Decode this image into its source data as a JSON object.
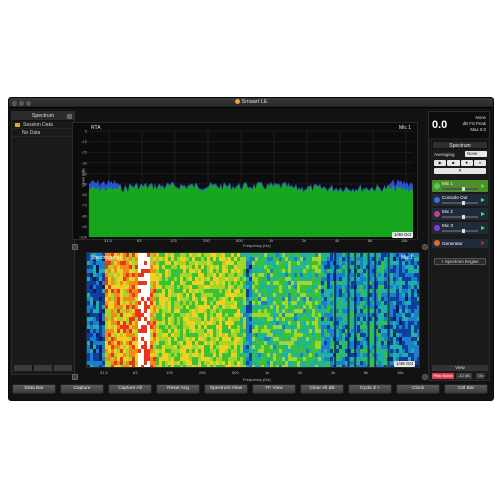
{
  "window": {
    "title": "Smaart LE"
  },
  "left_panel": {
    "title": "Spectrum",
    "items": [
      {
        "label": "Session Data"
      },
      {
        "label": "No Data"
      }
    ]
  },
  "rta": {
    "label": "RTA",
    "input_label": "Mic 1",
    "y_axis_label": "Level (dB)",
    "y_ticks": [
      "0",
      "-10",
      "-20",
      "-30",
      "-40",
      "-50",
      "-60",
      "-70",
      "-80",
      "-90",
      "-100"
    ],
    "x_axis_label": "Frequency (Hz)",
    "x_ticks": [
      "31.5",
      "63",
      "125",
      "250",
      "500",
      "1k",
      "2k",
      "4k",
      "8k",
      "16k"
    ],
    "badge": "1/48 Oct"
  },
  "spectrograph": {
    "label": "Spectrograph",
    "input_label": "Mic 1",
    "x_axis_label": "Frequency (Hz)",
    "x_ticks": [
      "31.5",
      "63",
      "125",
      "250",
      "500",
      "1k",
      "2k",
      "4k",
      "8k",
      "16k"
    ],
    "badge": "1/48 Oct"
  },
  "right_panel": {
    "meter_value": "0.0",
    "meter_mode": "None",
    "meter_unit": "dB FS Peak",
    "meter_max": "Max 0.0",
    "section_title": "Spectrum",
    "averaging_label": "Averaging",
    "averaging_value": "None",
    "transport": [
      "▶",
      "■",
      "⏺",
      "⏸"
    ],
    "channels": [
      {
        "label": "Mic 1",
        "color": "#4a8f2a",
        "dot": "#55cc55"
      },
      {
        "label": "Console Out",
        "color": "#1f2a3a",
        "dot": "#3a6fd8"
      },
      {
        "label": "Mic 2",
        "color": "#1f2a3a",
        "dot": "#d43a8a"
      },
      {
        "label": "Mic 3",
        "color": "#1f2a3a",
        "dot": "#8a3ad4"
      },
      {
        "label": "Generator",
        "color": "#1f2a3a",
        "dot": "#e86a2a"
      }
    ],
    "spectrum_engine_label": "+ Spectrum Engine",
    "view_label": "View",
    "pink_noise_label": "Pink Noise",
    "extra_a": "-12 dB",
    "extra_b": "On"
  },
  "bottom_bar": {
    "buttons": [
      "Data Bar",
      "Capture",
      "Capture All",
      "Reset Avg",
      "Spectrum View",
      "TF View",
      "Clear All dB",
      "Cycle Z +",
      "Clock",
      "Ctrl Bar"
    ]
  },
  "colors": {
    "rta_fill": "#17a81f",
    "rta_fill_blue": "#2b4fd8"
  }
}
